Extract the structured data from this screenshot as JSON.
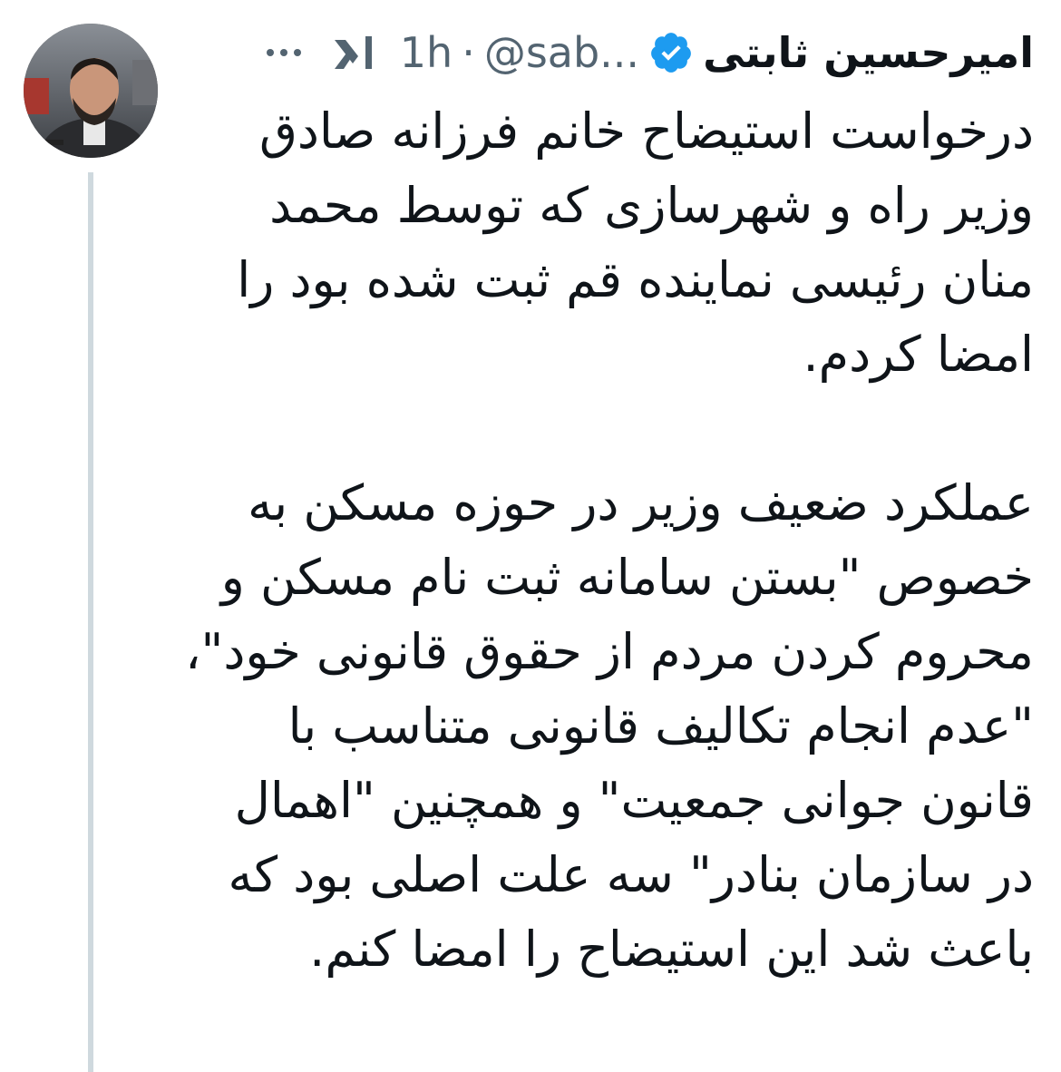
{
  "tweet": {
    "author_name": "امیرحسین ثابتی",
    "handle": "@sab...",
    "separator": "·",
    "time": "1h",
    "paragraphs": [
      "درخواست استیضاح خانم فرزانه صادق وزیر راه و شهرسازی که توسط محمد منان رئیسی نماینده قم ثبت شده بود را امضا کردم.",
      "عملکرد ضعیف وزیر در حوزه مسکن به خصوص \"بستن سامانه ثبت نام مسکن و محروم کردن مردم از حقوق قانونی خود\"، \"عدم انجام تکالیف قانونی متناسب با قانون جوانی جمعیت\" و همچنین \"اهمال در سازمان بنادر\" سه علت اصلی بود که باعث شد این استیضاح را امضا کنم."
    ]
  },
  "icons": {
    "verified": "verified-badge-icon",
    "grok": "xai-grok-icon",
    "more": "more-options-icon"
  },
  "colors": {
    "verified_blue": "#1d9bf0",
    "secondary_text": "#536471",
    "thread_line": "#cfd9de"
  }
}
